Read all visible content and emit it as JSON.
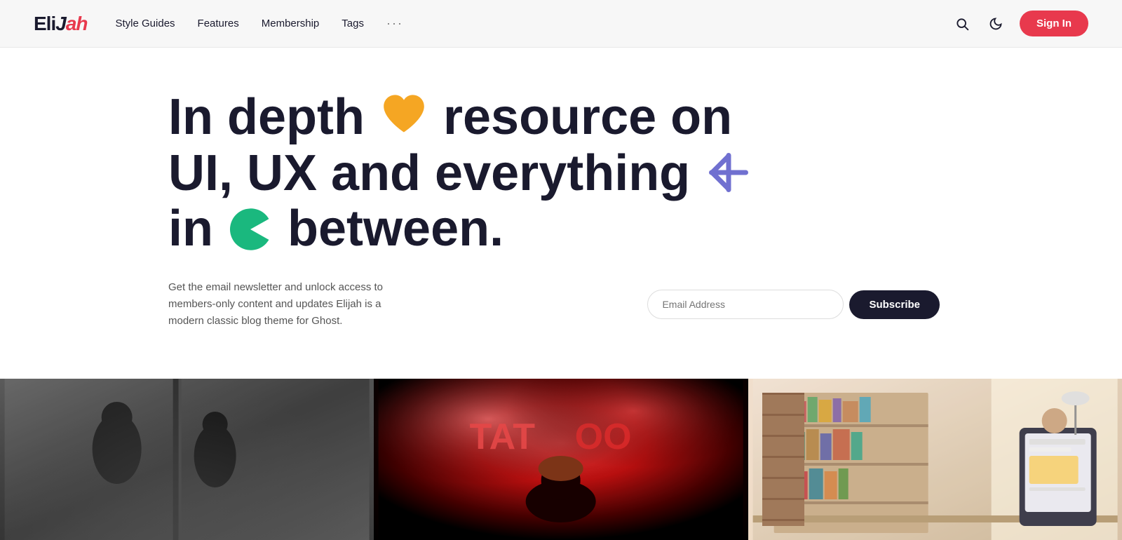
{
  "brand": {
    "name_eli": "Eli",
    "name_j": "J",
    "name_ah": "ah"
  },
  "navbar": {
    "links": [
      {
        "label": "Style Guides",
        "href": "#"
      },
      {
        "label": "Features",
        "href": "#"
      },
      {
        "label": "Membership",
        "href": "#"
      },
      {
        "label": "Tags",
        "href": "#"
      }
    ],
    "more_label": "···",
    "signin_label": "Sign In"
  },
  "hero": {
    "headline_part1": "In depth",
    "headline_part2": "resource on",
    "headline_part3": "UI, UX and everything",
    "headline_part4": "in",
    "headline_part5": "between.",
    "description": "Get the email newsletter and unlock access to members-only content and updates Elijah is a modern classic blog theme for Ghost.",
    "email_placeholder": "Email Address",
    "subscribe_label": "Subscribe"
  },
  "cards": [
    {
      "alt": "Two people in subway",
      "bg_class": "card-bg-1"
    },
    {
      "alt": "Person under neon lights",
      "bg_class": "card-bg-2"
    },
    {
      "alt": "Bookshelf with tablet",
      "bg_class": "card-bg-3"
    }
  ],
  "icons": {
    "search": "🔍",
    "moon": "🌙",
    "heart": "🧡",
    "star": "✳",
    "pacman": "●"
  }
}
